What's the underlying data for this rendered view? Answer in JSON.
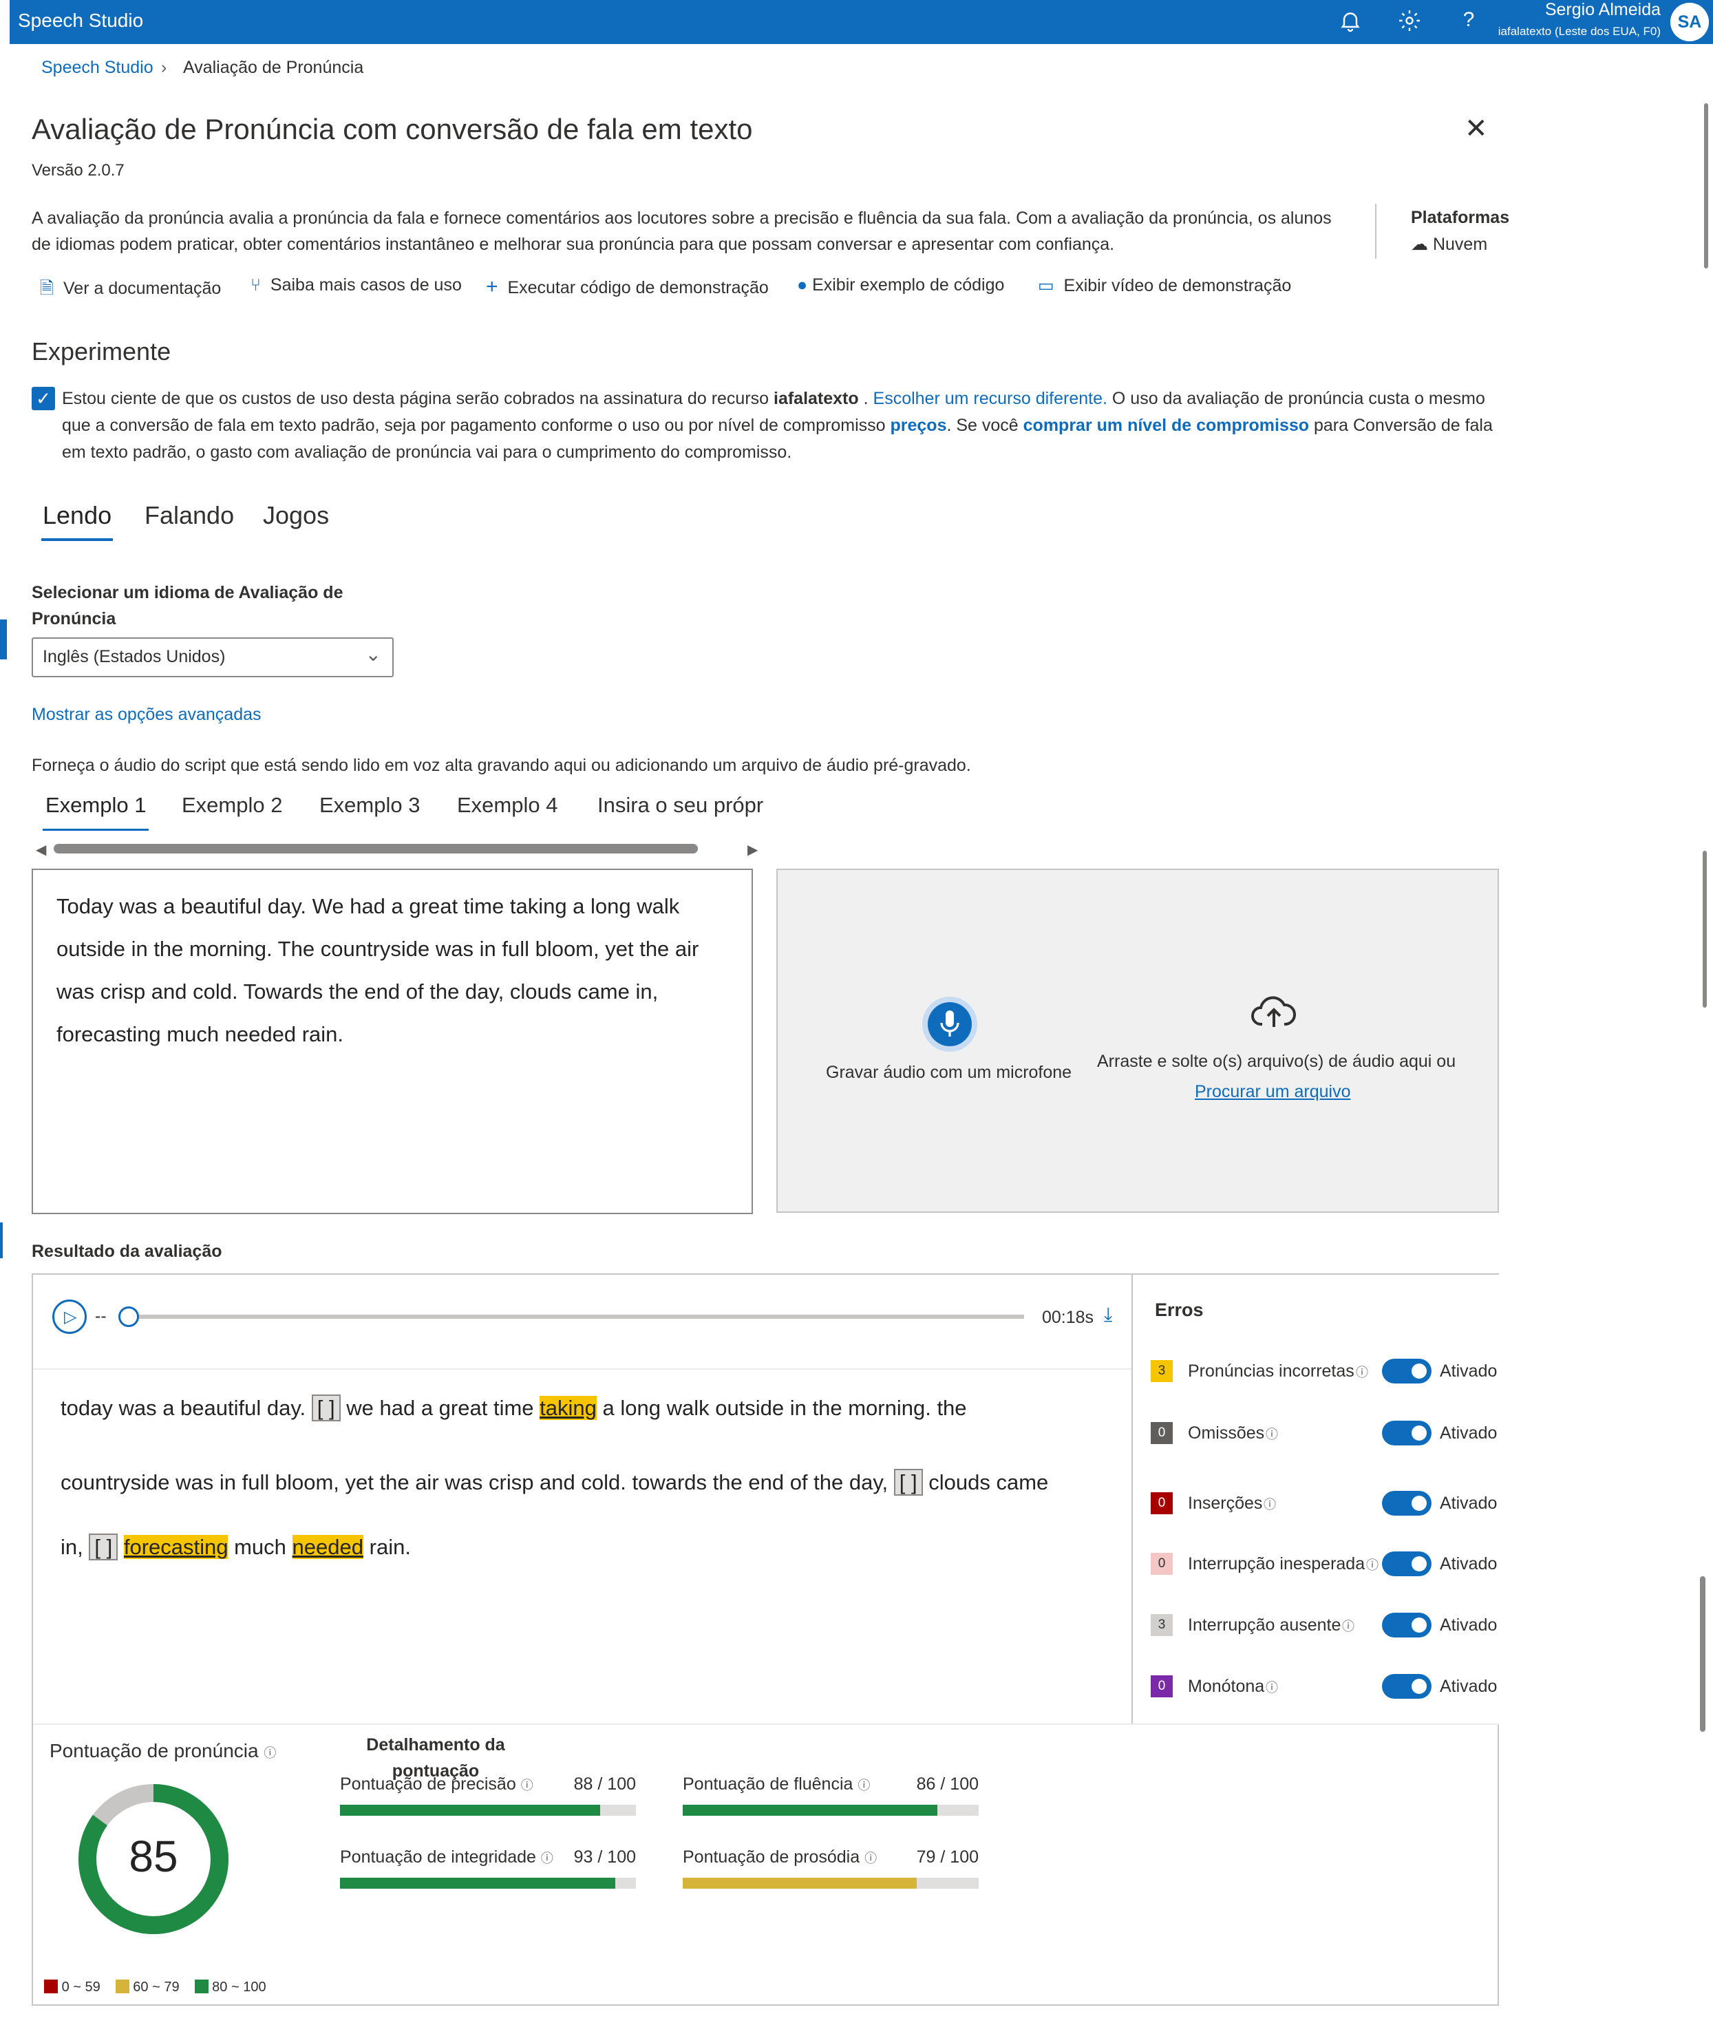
{
  "topbar": {
    "brand": "Speech Studio",
    "user_name": "Sergio Almeida",
    "user_tenant": "iafalatexto (Leste dos EUA, F0)",
    "avatar_initials": "SA"
  },
  "breadcrumb": {
    "root": "Speech Studio",
    "current": "Avaliação de Pronúncia"
  },
  "header": {
    "title": "Avaliação de Pronúncia com conversão de fala em texto",
    "version": "Versão 2.0.7",
    "description": "A avaliação da pronúncia avalia a pronúncia da fala e fornece comentários aos locutores sobre a precisão e fluência da sua fala. Com a avaliação da pronúncia, os alunos de idiomas podem praticar, obter comentários instantâneo e melhorar sua pronúncia para que possam conversar e apresentar com confiança.",
    "platforms_title": "Plataformas",
    "platform_cloud": "Nuvem"
  },
  "actions": {
    "docs": "Ver a documentação",
    "use_cases": "Saiba mais casos de uso",
    "run_demo": "Executar código de demonstração",
    "sample_code": "Exibir exemplo de código",
    "demo_video": "Exibir vídeo de demonstração"
  },
  "experiment": {
    "heading": "Experimente",
    "consent_part1": "Estou ciente de que os custos de uso desta página serão cobrados na assinatura do recurso ",
    "resource": "iafalatexto",
    "consent_part2": " . ",
    "change_resource": "Escolher um recurso diferente.",
    "consent_part3": " O uso da avaliação de pronúncia custa o mesmo que a conversão de fala em texto padrão, seja por pagamento conforme o uso ou por nível de compromisso ",
    "pricing": "preços",
    "consent_part4": ". Se você ",
    "buy_tier": "comprar um nível de compromisso",
    "consent_part5": " para Conversão de fala em texto padrão, o gasto com avaliação de pronúncia vai para o cumprimento do compromisso."
  },
  "tabs": [
    "Lendo",
    "Falando",
    "Jogos"
  ],
  "language": {
    "label": "Selecionar um idioma de Avaliação de Pronúncia",
    "selected": "Inglês (Estados Unidos)",
    "advanced": "Mostrar as opções avançadas"
  },
  "provide_audio_text": "Forneça o áudio do script que está sendo lido em voz alta gravando aqui ou adicionando um arquivo de áudio pré-gravado.",
  "example_tabs": [
    "Exemplo 1",
    "Exemplo 2",
    "Exemplo 3",
    "Exemplo 4",
    "Insira o seu própr"
  ],
  "script_text": "Today was a beautiful day. We had a great time taking a long walk outside in the morning. The countryside was in full bloom, yet the air was crisp and cold. Towards the end of the day, clouds came in, forecasting much needed rain.",
  "upload": {
    "record": "Gravar áudio com um microfone",
    "drag_drop": "Arraste e solte o(s) arquivo(s) de áudio aqui ou",
    "browse": "Procurar um arquivo"
  },
  "result": {
    "heading": "Resultado da avaliação",
    "time_start": "--",
    "time_end": "00:18s",
    "transcript": {
      "l1a": "today was a beautiful day.",
      "l1b": "we had a great time",
      "l1c": "taking",
      "l1d": "a long walk outside in the morning. the",
      "l2a": "countryside was in full bloom, yet the air was crisp and cold. towards the end of the day,",
      "l2b": "clouds came",
      "l3a": "in,",
      "l3b": "forecasting",
      "l3c": "much",
      "l3d": "needed",
      "l3e": "rain.",
      "gap": "[ ]"
    }
  },
  "errors": {
    "title": "Erros",
    "items": [
      {
        "count": "3",
        "label": "Pronúncias incorretas",
        "state": "Ativado",
        "color": "#f7c500",
        "text": "#323130"
      },
      {
        "count": "0",
        "label": "Omissões",
        "state": "Ativado",
        "color": "#605e5c",
        "text": "#ffffff"
      },
      {
        "count": "0",
        "label": "Inserções",
        "state": "Ativado",
        "color": "#a80000",
        "text": "#ffffff"
      },
      {
        "count": "0",
        "label": "Interrupção inesperada",
        "state": "Ativado",
        "color": "#f4c6c6",
        "text": "#323130"
      },
      {
        "count": "3",
        "label": "Interrupção ausente",
        "state": "Ativado",
        "color": "#d2d0ce",
        "text": "#323130"
      },
      {
        "count": "0",
        "label": "Monótona",
        "state": "Ativado",
        "color": "#7a29a8",
        "text": "#ffffff"
      }
    ]
  },
  "scores": {
    "title": "Pontuação de pronúncia",
    "overall": 85,
    "breakdown_title": "Detalhamento da pontuação",
    "items": [
      {
        "label": "Pontuação de precisão",
        "value": 88,
        "display": "88 / 100",
        "color": "#1e8a44"
      },
      {
        "label": "Pontuação de fluência",
        "value": 86,
        "display": "86 / 100",
        "color": "#1e8a44"
      },
      {
        "label": "Pontuação de integridade",
        "value": 93,
        "display": "93 / 100",
        "color": "#1e8a44"
      },
      {
        "label": "Pontuação de prosódia",
        "value": 79,
        "display": "79 / 100",
        "color": "#d6b43a"
      }
    ],
    "legend": [
      {
        "label": "0 ~ 59",
        "color": "#a80000"
      },
      {
        "label": "60 ~ 79",
        "color": "#d6b43a"
      },
      {
        "label": "80 ~ 100",
        "color": "#1e8a44"
      }
    ]
  }
}
